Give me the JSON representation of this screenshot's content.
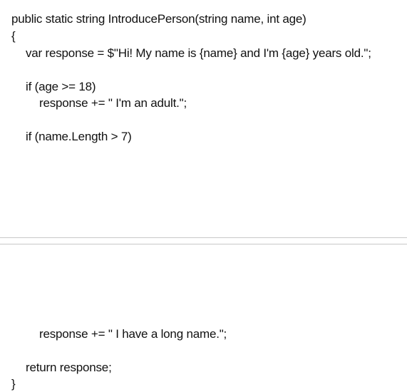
{
  "code": {
    "signature": "public static string IntroducePerson(string name, int age)",
    "open_brace": "{",
    "response_decl": "var response = $\"Hi! My name is {name} and I'm {age} years old.\";",
    "if_age": "if (age >= 18)",
    "adult_append": "response += \" I'm an adult.\";",
    "if_name_length": "if (name.Length > 7)",
    "long_name_append": "response += \" I have a long name.\";",
    "return_stmt": "return response;",
    "close_brace": "}"
  }
}
